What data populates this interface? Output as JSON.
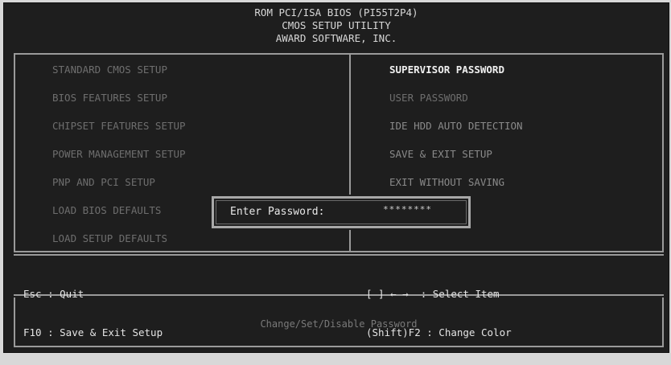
{
  "header": {
    "line1": "ROM PCI/ISA BIOS (PI55T2P4)",
    "line2": "CMOS SETUP UTILITY",
    "line3": "AWARD SOFTWARE, INC."
  },
  "menu": {
    "left": [
      "STANDARD CMOS SETUP",
      "BIOS FEATURES SETUP",
      "CHIPSET FEATURES SETUP",
      "POWER MANAGEMENT SETUP",
      "PNP AND PCI SETUP",
      "LOAD BIOS DEFAULTS",
      "LOAD SETUP DEFAULTS"
    ],
    "right": [
      "SUPERVISOR PASSWORD",
      "USER PASSWORD",
      "IDE HDD AUTO DETECTION",
      "SAVE & EXIT SETUP",
      "EXIT WITHOUT SAVING"
    ],
    "selected": "SUPERVISOR PASSWORD"
  },
  "dialog": {
    "label": "Enter Password:",
    "value": "********"
  },
  "keys": {
    "left_line1": "Esc : Quit",
    "left_line2": "F10 : Save & Exit Setup",
    "right_line1": "[ ] ← →  : Select Item",
    "right_line2": "(Shift)F2 : Change Color"
  },
  "status": {
    "text": "Change/Set/Disable Password"
  }
}
